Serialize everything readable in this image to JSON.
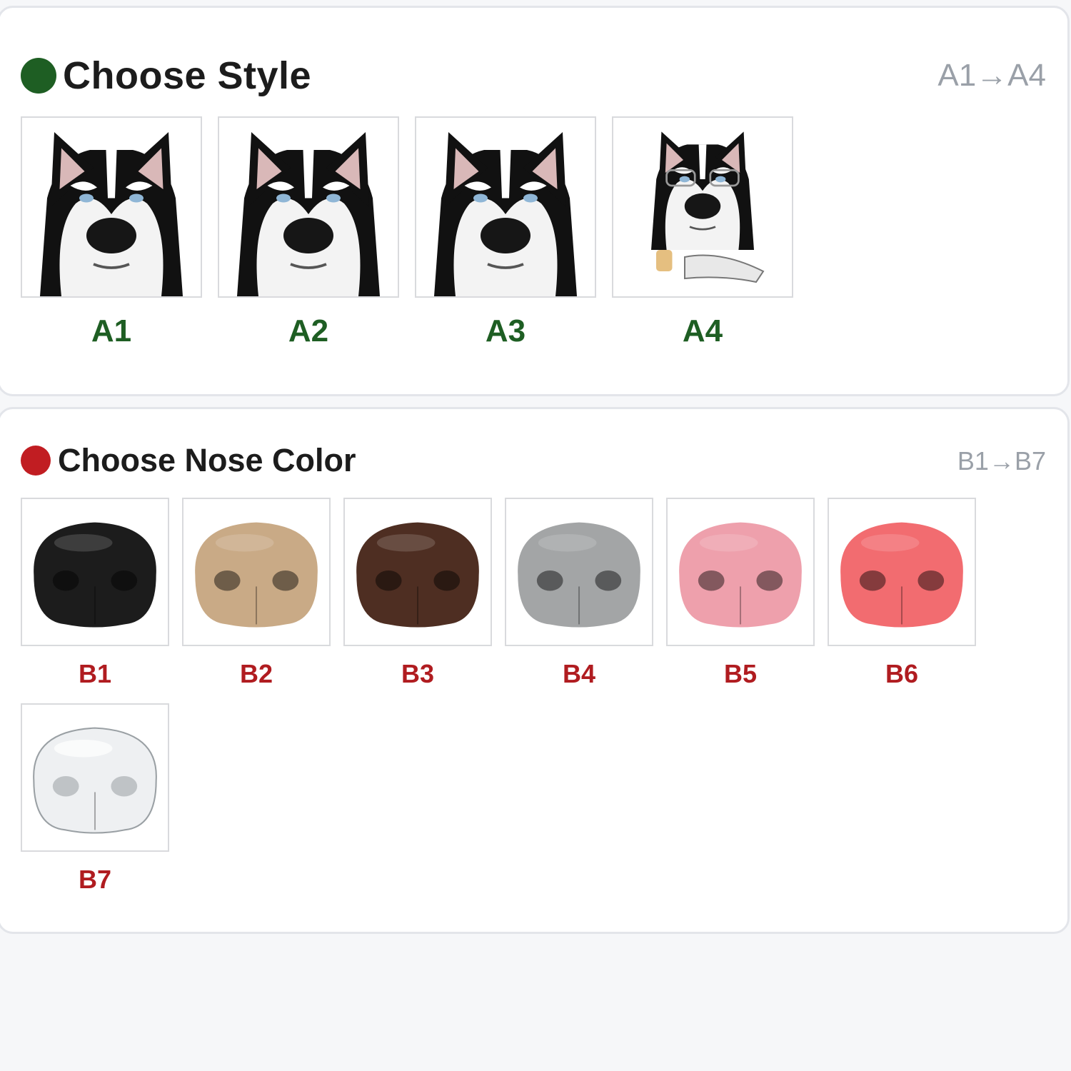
{
  "style_section": {
    "title": "Choose Style",
    "range": "A1→A4",
    "accent": "#1e5e23",
    "options": [
      {
        "code": "A1",
        "icon": "husky-face-photo-icon"
      },
      {
        "code": "A2",
        "icon": "husky-head-cutout-icon"
      },
      {
        "code": "A3",
        "icon": "husky-caricature-icon"
      },
      {
        "code": "A4",
        "icon": "husky-with-glasses-and-drink-icon"
      }
    ]
  },
  "nose_section": {
    "title": "Choose Nose Color",
    "range": "B1→B7",
    "accent": "#c11d22",
    "options": [
      {
        "code": "B1",
        "color": "#1c1c1c",
        "icon": "black-nose-icon"
      },
      {
        "code": "B2",
        "color": "#c9aa86",
        "icon": "tan-nose-icon"
      },
      {
        "code": "B3",
        "color": "#4e2e22",
        "icon": "brown-nose-icon"
      },
      {
        "code": "B4",
        "color": "#a3a5a6",
        "icon": "gray-nose-icon"
      },
      {
        "code": "B5",
        "color": "#eea0ac",
        "icon": "pink-nose-icon"
      },
      {
        "code": "B6",
        "color": "#f26c70",
        "icon": "red-nose-icon"
      },
      {
        "code": "B7",
        "color": "#eef0f2",
        "icon": "clear-nose-icon"
      }
    ]
  }
}
